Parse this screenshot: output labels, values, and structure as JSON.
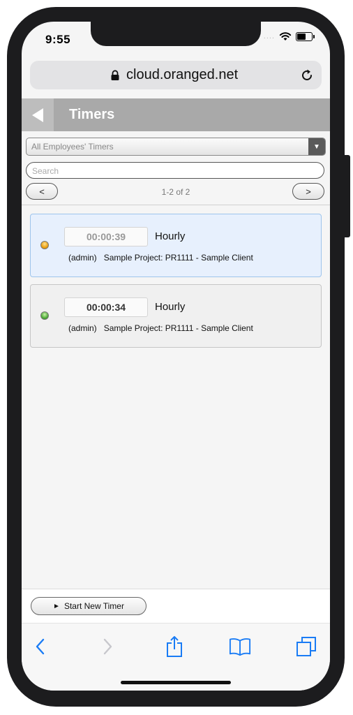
{
  "status_bar": {
    "time": "9:55",
    "signal": "....",
    "icons": [
      "wifi-icon",
      "battery-icon"
    ]
  },
  "browser": {
    "url": "cloud.oranged.net"
  },
  "header": {
    "title": "Timers"
  },
  "filter": {
    "selected": "All Employees' Timers"
  },
  "search": {
    "placeholder": "Search"
  },
  "pager": {
    "prev_label": "<",
    "next_label": ">",
    "info": "1-2 of 2"
  },
  "timers": [
    {
      "elapsed": "00:00:39",
      "rate": "Hourly",
      "user": "(admin)",
      "project": "Sample Project: PR1111 - Sample Client",
      "status_color": "#e69500"
    },
    {
      "elapsed": "00:00:34",
      "rate": "Hourly",
      "user": "(admin)",
      "project": "Sample Project: PR1111 - Sample Client",
      "status_color": "#3ea12a"
    }
  ],
  "actions": {
    "start_label": "Start New Timer"
  },
  "colors": {
    "header_bg": "#a9a9a9",
    "active_card_bg": "#e7f0fd",
    "ios_blue": "#1a7cf5"
  }
}
